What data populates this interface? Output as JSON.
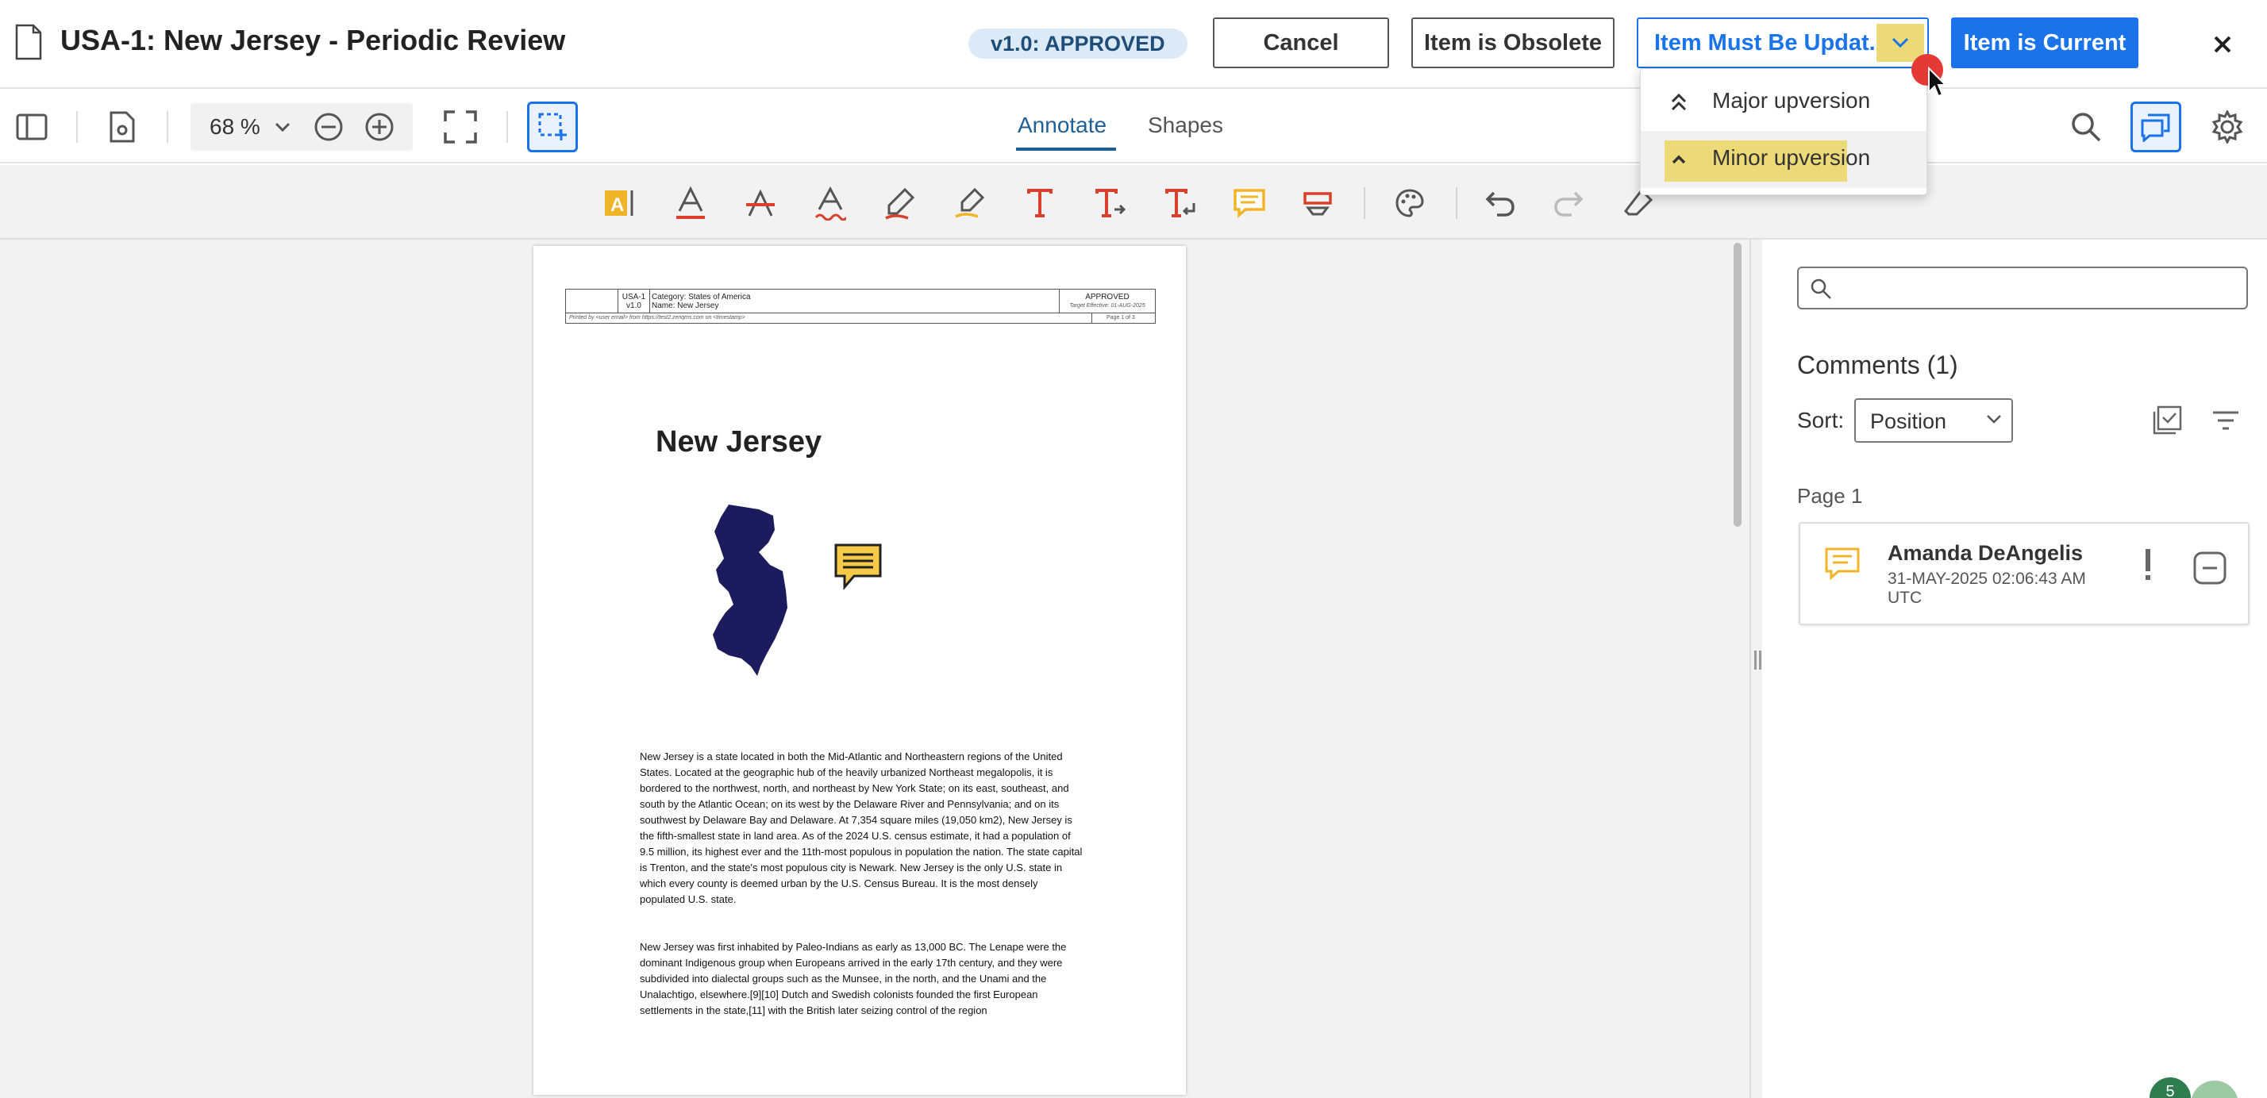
{
  "header": {
    "title": "USA-1: New Jersey - Periodic Review",
    "status": "v1.0: APPROVED",
    "cancel_label": "Cancel",
    "obsolete_label": "Item is Obsolete",
    "must_update_label": "Item Must Be Updat...",
    "current_label": "Item is Current"
  },
  "dropdown": {
    "items": [
      {
        "label": "Major upversion",
        "icon": "double-chevron-up-icon"
      },
      {
        "label": "Minor upversion",
        "icon": "chevron-up-icon",
        "highlighted": true
      }
    ]
  },
  "toolbar": {
    "zoom": "68 %",
    "tabs": [
      {
        "label": "Annotate",
        "active": true
      },
      {
        "label": "Shapes",
        "active": false
      }
    ]
  },
  "document": {
    "header": {
      "id": "USA-1",
      "version": "v1.0",
      "category_line": "Category: States of America",
      "name_line": "Name: New Jersey",
      "status": "APPROVED",
      "effective": "Target Effective: 01-AUG-2025",
      "printed_by": "Printed by <user email> from https://test2.zenqms.com on <timestamp>",
      "page_of": "Page 1 of 3"
    },
    "heading": "New Jersey",
    "paragraphs": [
      "New Jersey is a state located in both the Mid-Atlantic and Northeastern regions of the United States. Located at the geographic hub of the heavily urbanized Northeast megalopolis, it is bordered to the northwest, north, and northeast by New York State; on its east, southeast, and south by the Atlantic Ocean; on its west by the Delaware River and Pennsylvania; and on its southwest by Delaware Bay and Delaware. At 7,354 square miles (19,050 km2), New Jersey is the fifth-smallest state in land area. As of the 2024 U.S. census estimate, it had a population of 9.5 million, its highest ever and the 11th-most populous in population the nation. The state capital is Trenton, and the state's most populous city is Newark. New Jersey is the only U.S. state in which every county is deemed urban by the U.S. Census Bureau. It is the most densely populated U.S. state.",
      "New Jersey was first inhabited by Paleo-Indians as early as 13,000 BC. The Lenape were the dominant Indigenous group when Europeans arrived in the early 17th century, and they were subdivided into dialectal groups such as the Munsee, in the north, and the Unami and the Unalachtigo, elsewhere.[9][10] Dutch and Swedish colonists founded the first European settlements in the state,[11] with the British later seizing control of the region"
    ]
  },
  "comments_panel": {
    "search_placeholder": "",
    "title": "Comments (1)",
    "sort_label": "Sort:",
    "sort_value": "Position",
    "page_label": "Page 1",
    "comments": [
      {
        "author": "Amanda DeAngelis",
        "date": "31-MAY-2025 02:06:43 AM UTC"
      }
    ]
  },
  "bottom_badge": "5",
  "colors": {
    "primary": "#1a73e8",
    "highlight": "#ecd977",
    "status_pill_bg": "#dceaf7",
    "map_fill": "#1b1b5e",
    "annotation_red": "#d9402b",
    "annotation_yellow": "#f0b429"
  }
}
